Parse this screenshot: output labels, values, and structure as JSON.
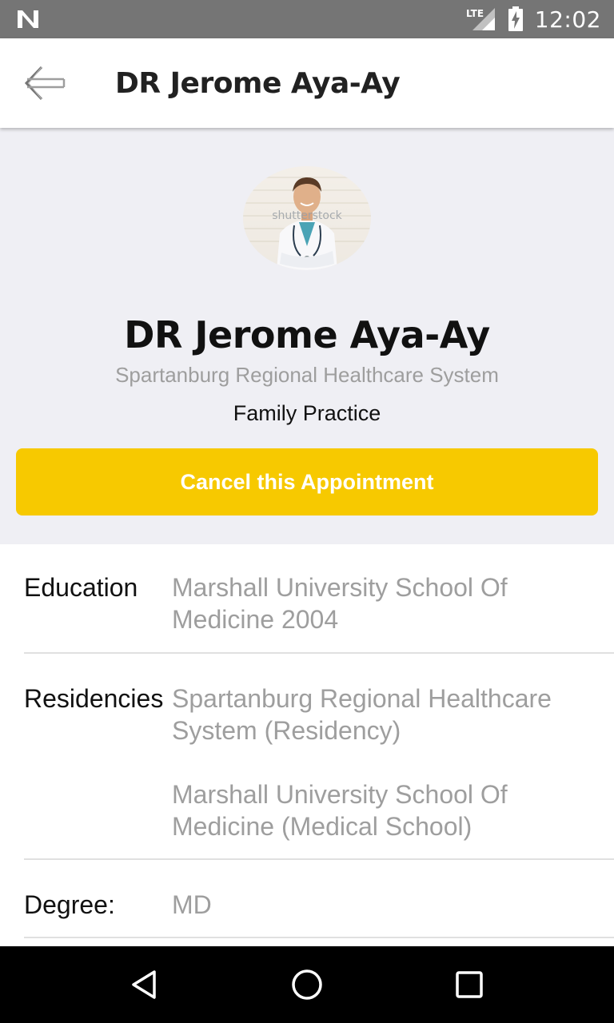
{
  "status_bar": {
    "time": "12:02",
    "network_label": "LTE",
    "icons": [
      "notification-n-icon",
      "lte-signal-icon",
      "battery-charging-icon"
    ]
  },
  "app_bar": {
    "title": "DR Jerome Aya-Ay",
    "back_icon": "back-arrow-icon"
  },
  "profile": {
    "avatar_watermark": "shutterstock",
    "name": "DR Jerome Aya-Ay",
    "hospital": "Spartanburg Regional Healthcare System",
    "specialty": "Family Practice",
    "cancel_button": "Cancel this Appointment"
  },
  "details": {
    "education": {
      "label": "Education",
      "values": [
        "Marshall University School Of Medicine 2004"
      ]
    },
    "residencies": {
      "label": "Residencies",
      "values": [
        "Spartanburg Regional Healthcare System (Residency)",
        "Marshall University School Of Medicine (Medical School)"
      ]
    },
    "degree": {
      "label": "Degree:",
      "values": [
        "MD"
      ]
    }
  },
  "colors": {
    "status_bar": "#757575",
    "header_bg": "#efeff4",
    "accent": "#f7c900",
    "muted_text": "#9e9e9e"
  }
}
